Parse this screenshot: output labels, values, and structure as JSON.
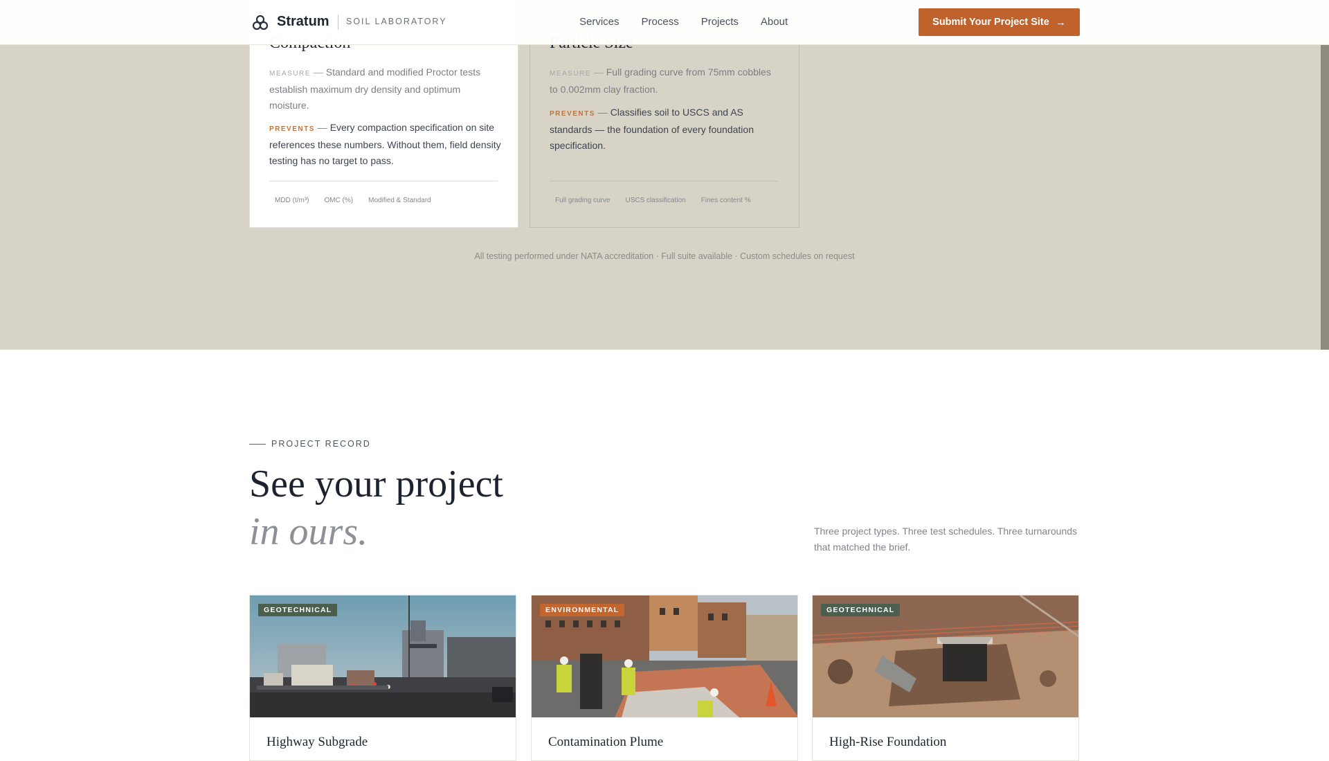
{
  "nav": {
    "brand": "Stratum",
    "subtitle": "SOIL LABORATORY",
    "links": [
      "Services",
      "Process",
      "Projects",
      "About"
    ],
    "cta_label": "Submit Your Project Site",
    "cta_arrow": "→"
  },
  "cards": [
    {
      "title": "Compaction",
      "measure_tag": "MEASURE",
      "measure_text": "Standard and modified Proctor tests establish maximum dry density and optimum moisture.",
      "prevents_tag": "PREVENTS",
      "prevents_text": "Every compaction specification on site references these numbers. Without them, field density testing has no target to pass.",
      "chips": [
        "MDD (t/m³)",
        "OMC (%)",
        "Modified & Standard"
      ]
    },
    {
      "title": "Particle Size",
      "measure_tag": "MEASURE",
      "measure_text": "Full grading curve from 75mm cobbles to 0.002mm clay fraction.",
      "prevents_tag": "PREVENTS",
      "prevents_text": "Classifies soil to USCS and AS standards — the foundation of every foundation specification.",
      "chips": [
        "Full grading curve",
        "USCS classification",
        "Fines content %"
      ]
    }
  ],
  "dash": "—",
  "accreditation_note": "All testing performed under NATA accreditation · Full suite available · Custom schedules on request",
  "projects_section": {
    "eyebrow": "PROJECT RECORD",
    "heading": "See your project",
    "heading_italic": "in ours.",
    "intro": "Three project types. Three test schedules. Three turnarounds that matched the brief.",
    "items": [
      {
        "badge": "GEOTECHNICAL",
        "title": "Highway Subgrade"
      },
      {
        "badge": "ENVIRONMENTAL",
        "title": "Contamination Plume"
      },
      {
        "badge": "GEOTECHNICAL",
        "title": "High-Rise Foundation"
      }
    ]
  },
  "colors": {
    "accent": "#c0622c",
    "beige_section": "#d7d3c6",
    "badge_geotechnical": "#4c5f4f",
    "badge_environmental": "#c2652f"
  }
}
